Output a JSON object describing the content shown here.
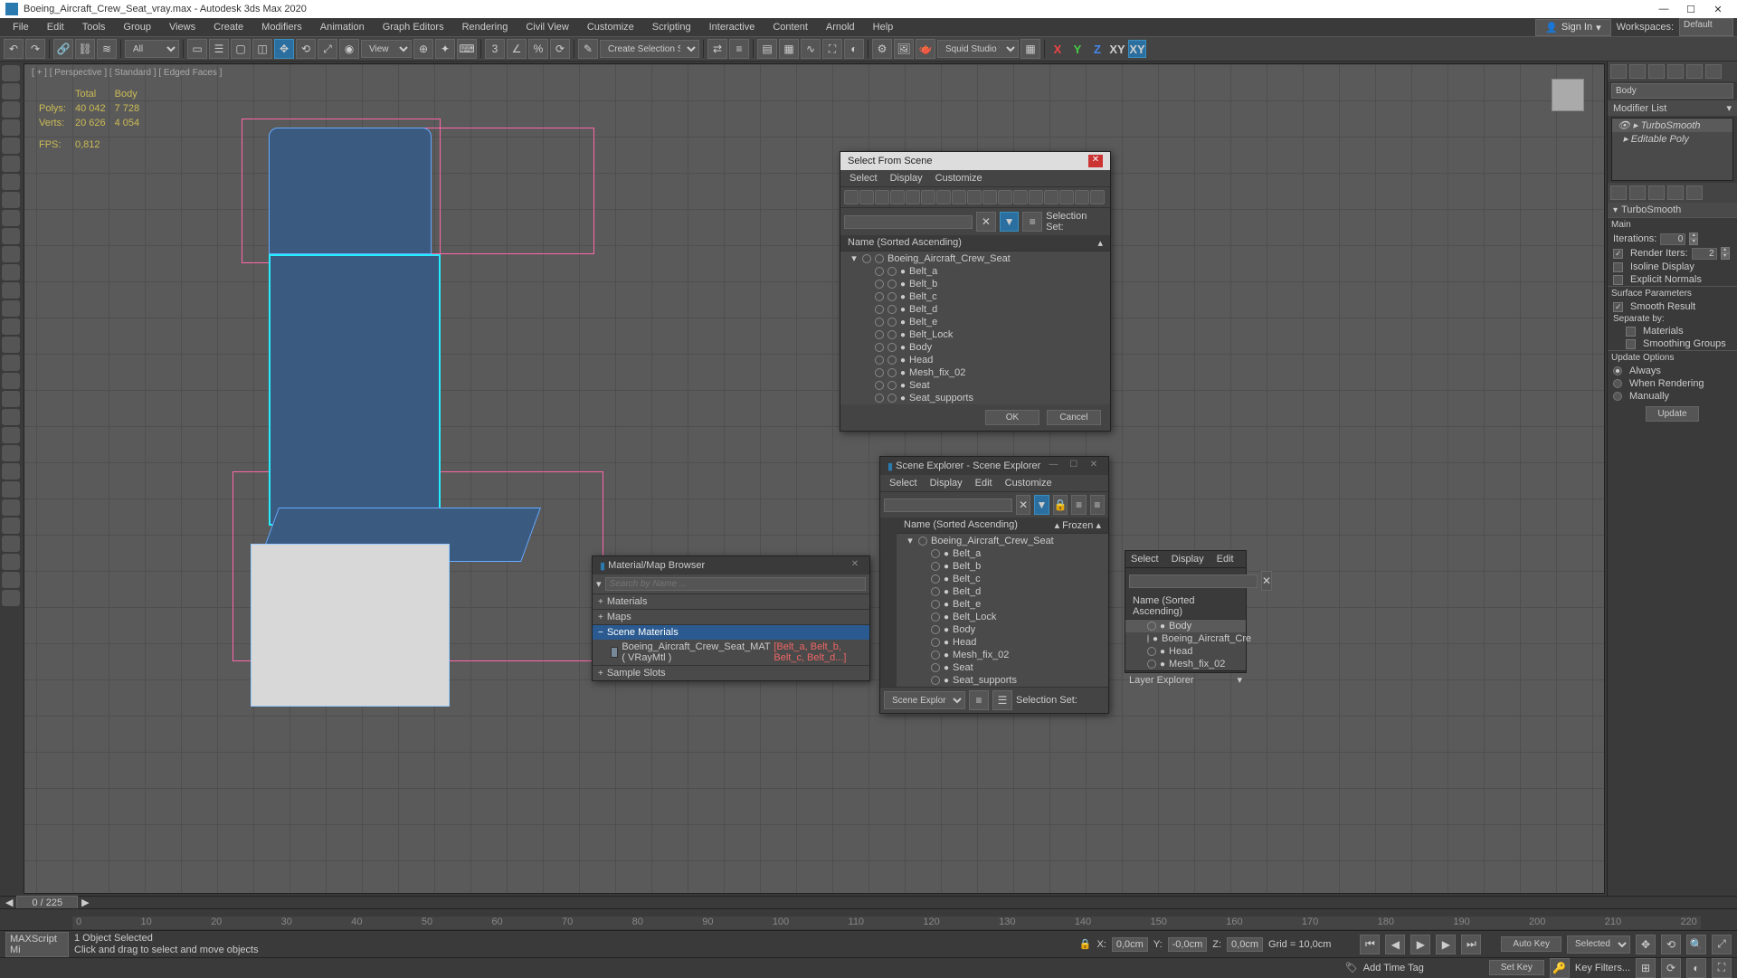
{
  "title": "Boeing_Aircraft_Crew_Seat_vray.max - Autodesk 3ds Max 2020",
  "menus": [
    "File",
    "Edit",
    "Tools",
    "Group",
    "Views",
    "Create",
    "Modifiers",
    "Animation",
    "Graph Editors",
    "Rendering",
    "Civil View",
    "Customize",
    "Scripting",
    "Interactive",
    "Content",
    "Arnold",
    "Help"
  ],
  "signin": "Sign In",
  "workspaces_label": "Workspaces:",
  "workspaces_value": "Default",
  "toolbar": {
    "all": "All",
    "view": "View",
    "create_sel": "Create Selection Se",
    "squid": "Squid Studio v"
  },
  "axes": [
    "X",
    "Y",
    "Z",
    "XY",
    "XY"
  ],
  "viewport_label": "[ + ] [ Perspective ] [ Standard ] [ Edged Faces ]",
  "stats": {
    "h_total": "Total",
    "h_body": "Body",
    "polys_l": "Polys:",
    "polys_t": "40 042",
    "polys_b": "7 728",
    "verts_l": "Verts:",
    "verts_t": "20 626",
    "verts_b": "4 054",
    "fps_l": "FPS:",
    "fps_v": "0,812"
  },
  "cmd_panel": {
    "obj_name": "Body",
    "modlist": "Modifier List",
    "modifiers": [
      "TurboSmooth",
      "Editable Poly"
    ],
    "rollout": "TurboSmooth",
    "main": "Main",
    "iter_l": "Iterations:",
    "iter_v": "0",
    "rend_l": "Render Iters:",
    "rend_v": "2",
    "isoline": "Isoline Display",
    "explicit": "Explicit Normals",
    "surf_params": "Surface Parameters",
    "smooth_res": "Smooth Result",
    "separate": "Separate by:",
    "materials": "Materials",
    "smoothgrp": "Smoothing Groups",
    "update_opt": "Update Options",
    "always": "Always",
    "when_render": "When Rendering",
    "manually": "Manually",
    "update_btn": "Update"
  },
  "select_scene": {
    "title": "Select From Scene",
    "menus": [
      "Select",
      "Display",
      "Customize"
    ],
    "selset": "Selection Set:",
    "col": "Name (Sorted Ascending)",
    "root": "Boeing_Aircraft_Crew_Seat",
    "items": [
      "Belt_a",
      "Belt_b",
      "Belt_c",
      "Belt_d",
      "Belt_e",
      "Belt_Lock",
      "Body",
      "Head",
      "Mesh_fix_02",
      "Seat",
      "Seat_supports"
    ],
    "ok": "OK",
    "cancel": "Cancel"
  },
  "scene_explorer": {
    "title": "Scene Explorer - Scene Explorer",
    "menus": [
      "Select",
      "Display",
      "Edit",
      "Customize"
    ],
    "col": "Name (Sorted Ascending)",
    "frozen": "Frozen",
    "root": "Boeing_Aircraft_Crew_Seat",
    "items": [
      "Belt_a",
      "Belt_b",
      "Belt_c",
      "Belt_d",
      "Belt_e",
      "Belt_Lock",
      "Body",
      "Head",
      "Mesh_fix_02",
      "Seat",
      "Seat_supports"
    ],
    "footer": "Scene Explorer",
    "selset": "Selection Set:"
  },
  "matbrowser": {
    "title": "Material/Map Browser",
    "search": "Search by Name ...",
    "sections": [
      "Materials",
      "Maps",
      "Scene Materials",
      "Sample Slots"
    ],
    "item_name": "Boeing_Aircraft_Crew_Seat_MAT ( VRayMtl )",
    "item_assign": "[Belt_a, Belt_b, Belt_c, Belt_d...]"
  },
  "lr_panel": {
    "tabs": [
      "Select",
      "Display",
      "Edit"
    ],
    "col": "Name (Sorted Ascending)",
    "items": [
      "Body",
      "Boeing_Aircraft_Cre",
      "Head",
      "Mesh_fix_02"
    ],
    "footer": "Layer Explorer"
  },
  "timeline": {
    "pos": "0 / 225",
    "ticks": [
      "0",
      "10",
      "20",
      "30",
      "40",
      "50",
      "60",
      "70",
      "80",
      "90",
      "100",
      "110",
      "120",
      "130",
      "140",
      "150",
      "160",
      "170",
      "180",
      "190",
      "200",
      "210",
      "220"
    ]
  },
  "status": {
    "selected": "1 Object Selected",
    "prompt": "Click and drag to select and move objects",
    "maxscript": "MAXScript Mi",
    "x": "X:",
    "xv": "0,0cm",
    "y": "Y:",
    "yv": "-0,0cm",
    "z": "Z:",
    "zv": "0,0cm",
    "grid": "Grid = 10,0cm",
    "autokey": "Auto Key",
    "setkey": "Set Key",
    "selected_dd": "Selected",
    "keyfilters": "Key Filters...",
    "addtag": "Add Time Tag"
  }
}
